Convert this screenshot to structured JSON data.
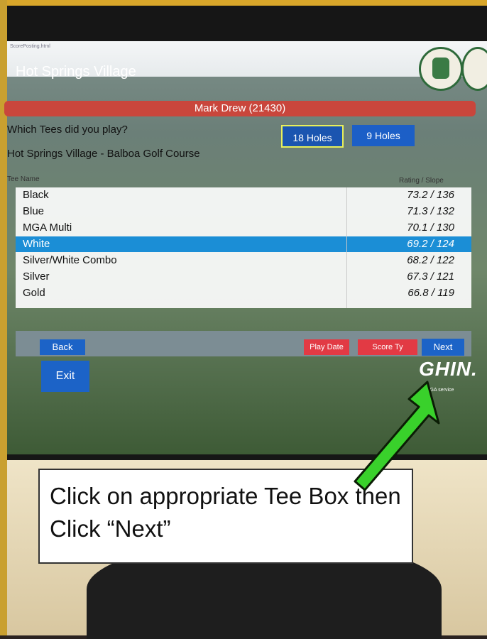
{
  "browser": {
    "url": "ScorePosting.html"
  },
  "header": {
    "title": "Hot Springs Village"
  },
  "player": {
    "name": "Mark Drew (21430)"
  },
  "prompt": {
    "question": "Which Tees did you play?",
    "course": "Hot Springs Village - Balboa Golf Course"
  },
  "hole_options": {
    "eighteen": "18 Holes",
    "nine": "9 Holes"
  },
  "columns": {
    "tee": "Tee Name",
    "rating": "Rating / Slope"
  },
  "tees": [
    {
      "name": "Black",
      "rs": "73.2 / 136"
    },
    {
      "name": "Blue",
      "rs": "71.3 / 132"
    },
    {
      "name": "MGA Multi",
      "rs": "70.1 / 130"
    },
    {
      "name": "White",
      "rs": "69.2 / 124"
    },
    {
      "name": "Silver/White Combo",
      "rs": "68.2 / 122"
    },
    {
      "name": "Silver",
      "rs": "67.3 / 121"
    },
    {
      "name": "Gold",
      "rs": "66.8 / 119"
    }
  ],
  "toolbar": {
    "back": "Back",
    "play_date": "Play Date",
    "score_type": "Score Ty",
    "next": "Next"
  },
  "exit": "Exit",
  "brand": {
    "ghin": "GHIN.",
    "tagline": "a USGA service"
  },
  "callout": "Click on appropriate Tee Box then Click “Next”",
  "colors": {
    "selected_row": "#1b8ed6",
    "primary_button": "#1c63c7",
    "danger_button": "#e23a44",
    "player_bar": "#c9463c",
    "arrow": "#39d12b"
  }
}
